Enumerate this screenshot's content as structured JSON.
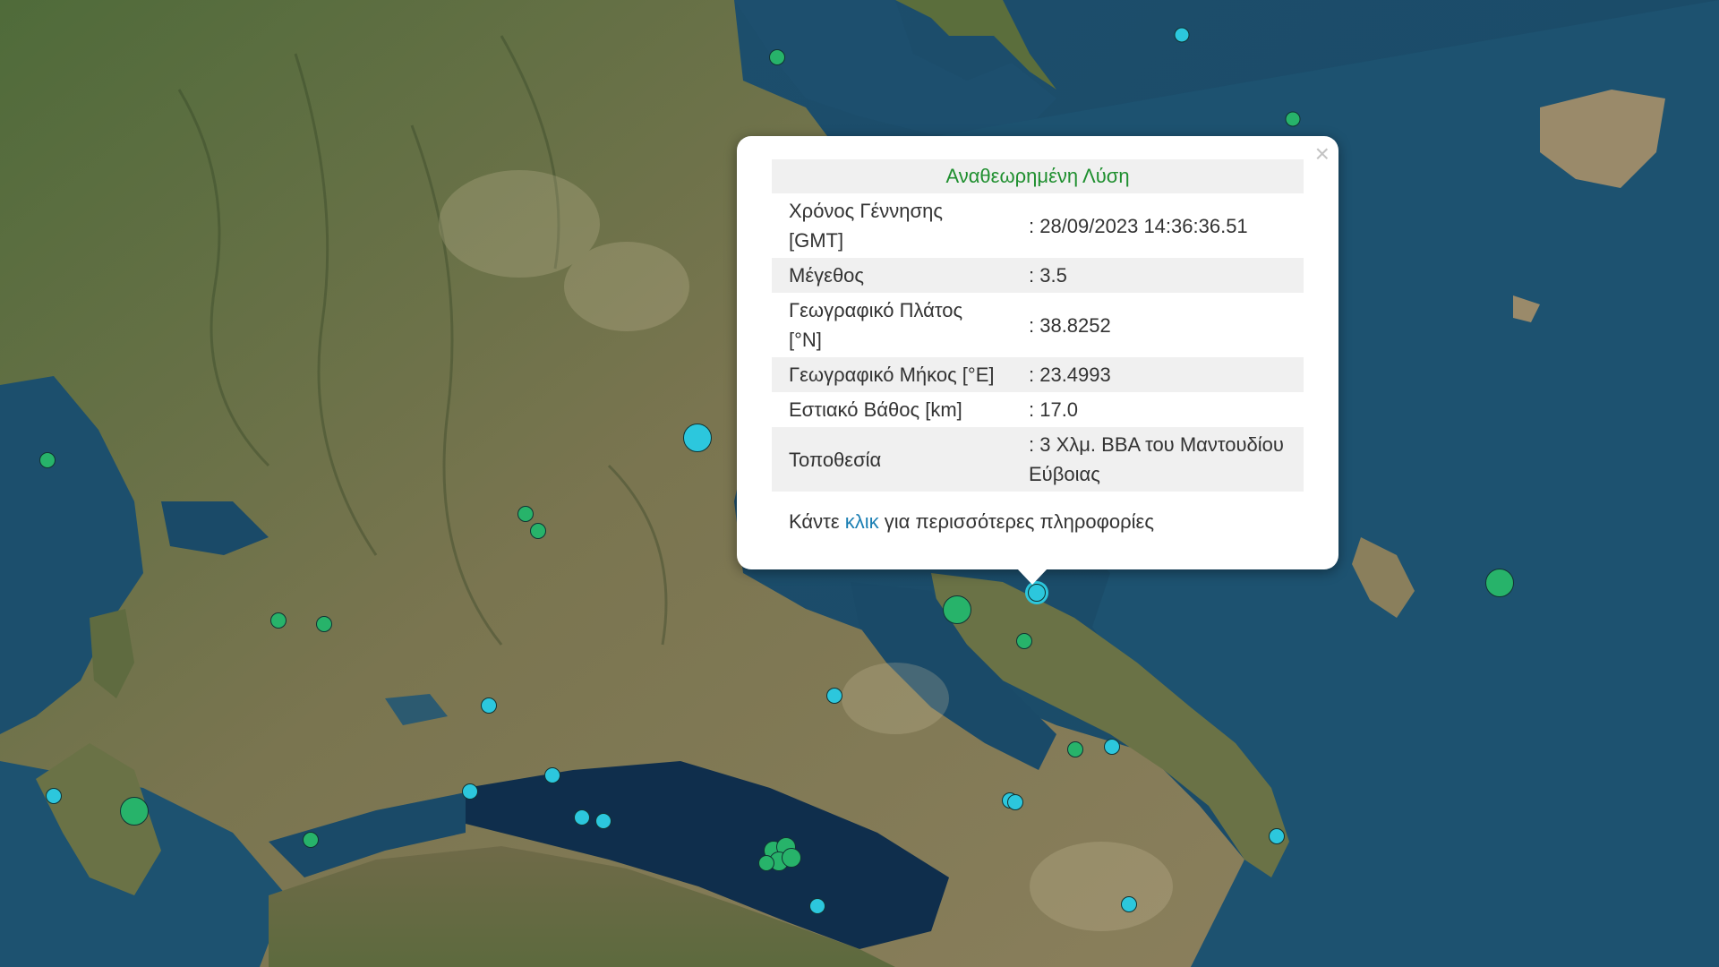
{
  "popup": {
    "header": "Αναθεωρημένη Λύση",
    "close_label": "×",
    "rows": [
      {
        "label": "Χρόνος Γέννησης [GMT]",
        "value": ": 28/09/2023 14:36:36.51"
      },
      {
        "label": "Μέγεθος",
        "value": ": 3.5"
      },
      {
        "label": "Γεωγραφικό Πλάτος [°N]",
        "value": ": 38.8252"
      },
      {
        "label": "Γεωγραφικό Μήκος [°E]",
        "value": ": 23.4993"
      },
      {
        "label": "Εστιακό Βάθος [km]",
        "value": ": 17.0"
      },
      {
        "label": "Τοποθεσία",
        "value": ": 3 Χλμ. ΒΒΑ του Μαντουδίου Εύβοιας"
      }
    ],
    "more_prefix": "Κάντε",
    "more_link": "κλικ",
    "more_suffix": "για περισσότερες πληροφορίες"
  },
  "colors": {
    "green_marker": "#27b36a",
    "cyan_marker": "#2cc7dd",
    "popup_header": "#1f8f2f",
    "link": "#1b7fb3"
  }
}
